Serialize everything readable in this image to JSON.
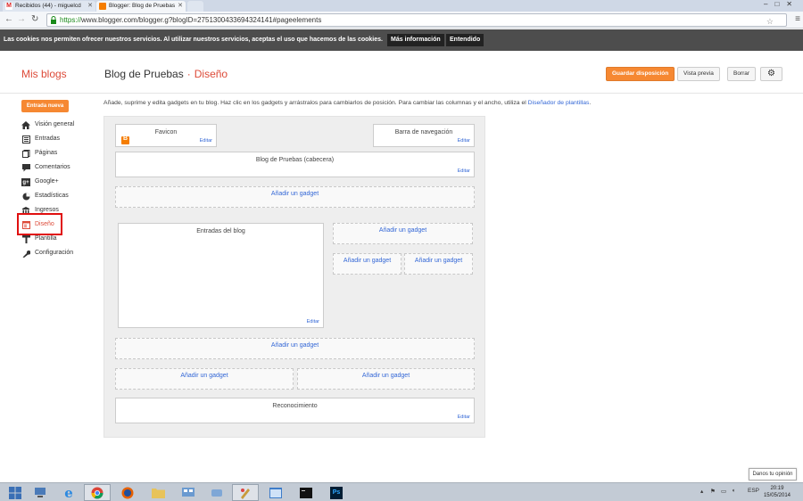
{
  "browser": {
    "tabs": [
      {
        "label": "Recibidos (44) - miguelcd"
      },
      {
        "label": "Blogger: Blog de Pruebas"
      }
    ],
    "url_scheme": "https://",
    "url_rest": "www.blogger.com/blogger.g?blogID=2751300433694324141#pageelements"
  },
  "cookie_bar": {
    "message": "Las cookies nos permiten ofrecer nuestros servicios. Al utilizar nuestros servicios, aceptas el uso que hacemos de las cookies.",
    "more_info": "Más información",
    "accept": "Entendido"
  },
  "header": {
    "my_blogs": "Mis blogs",
    "blog_name": "Blog de Pruebas",
    "separator": "·",
    "section": "Diseño",
    "save_layout": "Guardar disposición",
    "preview": "Vista previa",
    "discard": "Borrar"
  },
  "sidebar": {
    "new_post": "Entrada nueva",
    "items": [
      {
        "label": "Visión general",
        "icon": "home-icon"
      },
      {
        "label": "Entradas",
        "icon": "posts-icon"
      },
      {
        "label": "Páginas",
        "icon": "pages-icon"
      },
      {
        "label": "Comentarios",
        "icon": "comments-icon"
      },
      {
        "label": "Google+",
        "icon": "google-plus-icon"
      },
      {
        "label": "Estadísticas",
        "icon": "stats-icon"
      },
      {
        "label": "Ingresos",
        "icon": "earnings-icon"
      },
      {
        "label": "Diseño",
        "icon": "layout-icon"
      },
      {
        "label": "Plantilla",
        "icon": "template-icon"
      },
      {
        "label": "Configuración",
        "icon": "settings-icon"
      }
    ]
  },
  "main": {
    "intro": "Añade, suprime y edita gadgets en tu blog. Haz clic en los gadgets y arrástralos para cambiarlos de posición. Para cambiar las columnas y el ancho, utiliza el",
    "intro_link": "Diseñador de plantillas",
    "intro_end": ".",
    "edit": "Editar",
    "add_gadget": "Añadir un gadget",
    "favicon": "Favicon",
    "navbar": "Barra de navegación",
    "blog_header": "Blog de Pruebas (cabecera)",
    "blog_posts": "Entradas del blog",
    "attribution": "Reconocimiento"
  },
  "feedback": "Danos tu opinión",
  "taskbar": {
    "lang": "ESP",
    "time": "20:19",
    "date": "15/05/2014"
  },
  "colors": {
    "accent": "#dd4b39",
    "orange_button": "#f68832",
    "link": "#3367d6"
  }
}
